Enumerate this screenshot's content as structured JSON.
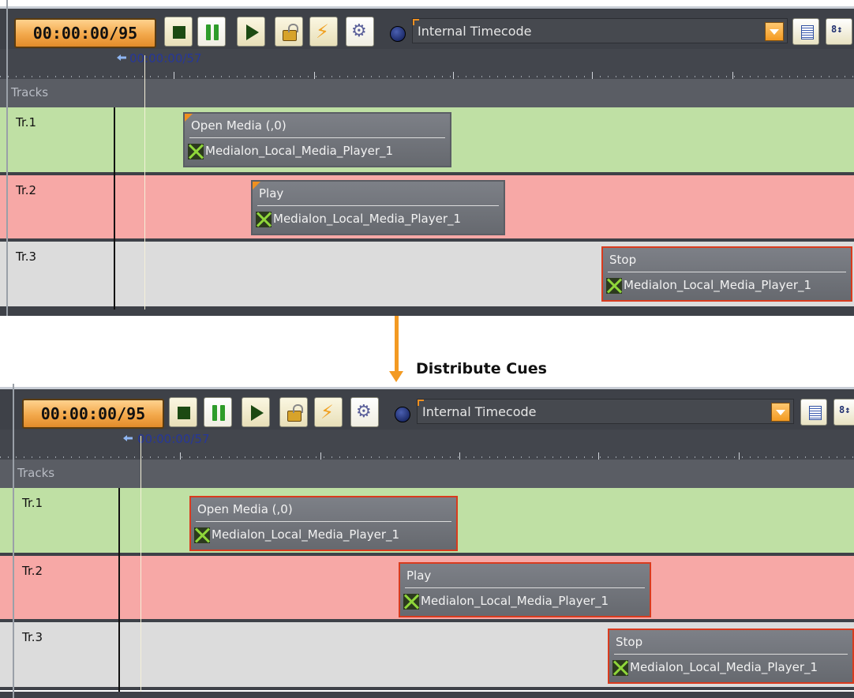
{
  "panels": [
    {
      "timecode": "00:00:00/95",
      "timecode_source": "Internal Timecode",
      "ruler_position": "00:00:00/57",
      "tracks_header": "Tracks",
      "tracks": [
        {
          "name": "Tr.1",
          "color": "#bfe0a4",
          "cue": {
            "title": "Open Media (,0)",
            "device": "Medialon_Local_Media_Player_1",
            "selected": false
          }
        },
        {
          "name": "Tr.2",
          "color": "#f7a8a6",
          "cue": {
            "title": "Play",
            "device": "Medialon_Local_Media_Player_1",
            "selected": false
          }
        },
        {
          "name": "Tr.3",
          "color": "#dcdcdc",
          "cue": {
            "title": "Stop",
            "device": "Medialon_Local_Media_Player_1",
            "selected": true
          }
        }
      ]
    },
    {
      "timecode": "00:00:00/95",
      "timecode_source": "Internal Timecode",
      "ruler_position": "00:00:00/57",
      "tracks_header": "Tracks",
      "tracks": [
        {
          "name": "Tr.1",
          "color": "#bfe0a4",
          "cue": {
            "title": "Open Media (,0)",
            "device": "Medialon_Local_Media_Player_1",
            "selected": true
          }
        },
        {
          "name": "Tr.2",
          "color": "#f7a8a6",
          "cue": {
            "title": "Play",
            "device": "Medialon_Local_Media_Player_1",
            "selected": true
          }
        },
        {
          "name": "Tr.3",
          "color": "#dcdcdc",
          "cue": {
            "title": "Stop",
            "device": "Medialon_Local_Media_Player_1",
            "selected": true
          }
        }
      ]
    }
  ],
  "transition_label": "Distribute Cues",
  "accent_color": "#f39a22",
  "icons": [
    "stop-icon",
    "pause-icon",
    "play-icon",
    "lock-icon",
    "lightning-icon",
    "link-icon",
    "timecode-globe-icon",
    "dropdown-arrow-icon",
    "list-view-icon",
    "sort-icon"
  ]
}
